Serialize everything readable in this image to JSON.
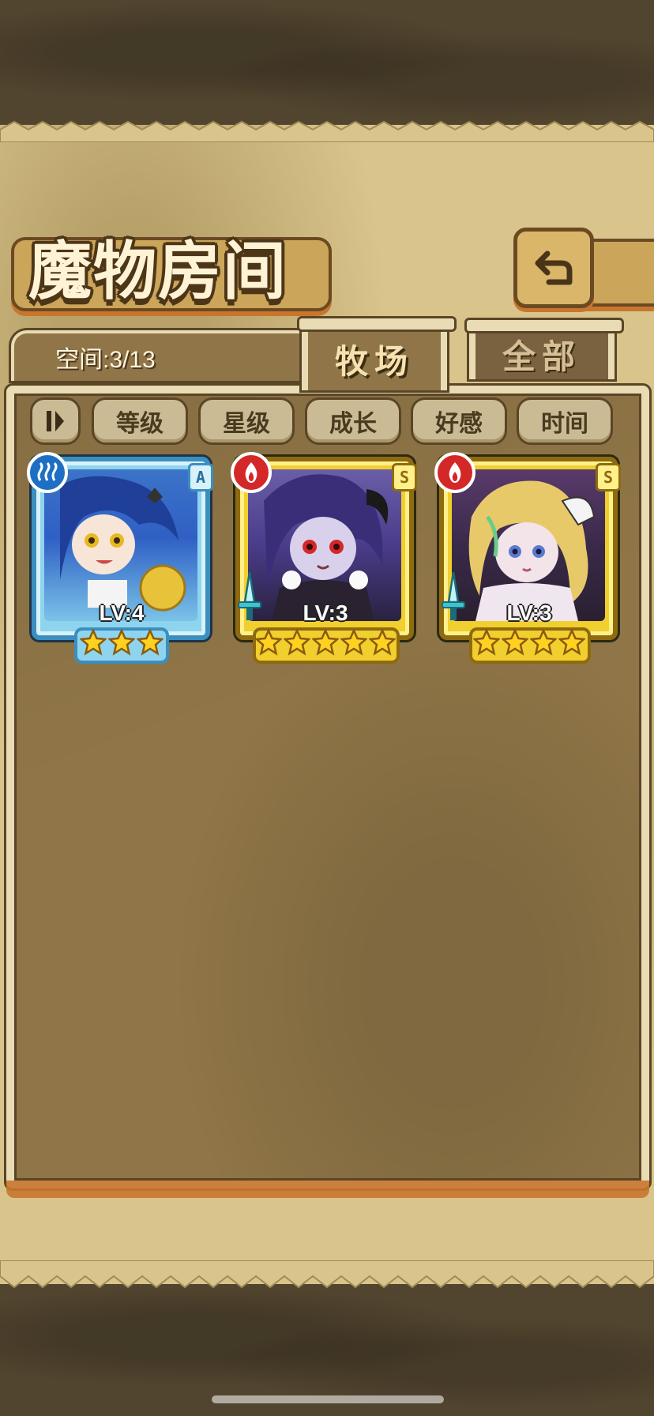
{
  "header": {
    "title": "魔物房间"
  },
  "capacity": {
    "text": "空间:3/13"
  },
  "tabs": [
    {
      "label": "牧场",
      "active": true
    },
    {
      "label": "全部",
      "active": false
    }
  ],
  "sort": {
    "buttons": [
      "等级",
      "星级",
      "成长",
      "好感",
      "时间"
    ]
  },
  "monsters": [
    {
      "level": "LV:4",
      "rank": "A",
      "element": "water",
      "stars": 3,
      "frame": "blue",
      "colors": {
        "hair": "#2f5fc4",
        "accent": "#e8c33a"
      }
    },
    {
      "level": "LV:3",
      "rank": "S",
      "element": "fire",
      "stars": 5,
      "frame": "gold",
      "colors": {
        "hair": "#4a3c8a",
        "accent": "#d43a3a"
      }
    },
    {
      "level": "LV:3",
      "rank": "S",
      "element": "fire",
      "stars": 4,
      "frame": "gold",
      "colors": {
        "hair": "#e8c96a",
        "accent": "#8f3a9a"
      }
    }
  ],
  "colors": {
    "panel": "#8f7547",
    "panel_border": "#e9dcb4",
    "parchment": "#d9c58c",
    "frame_water": "#3a8fbf",
    "frame_gold": "#f0cf2e",
    "element_water": "#1d6fc4",
    "element_fire": "#d42828"
  }
}
